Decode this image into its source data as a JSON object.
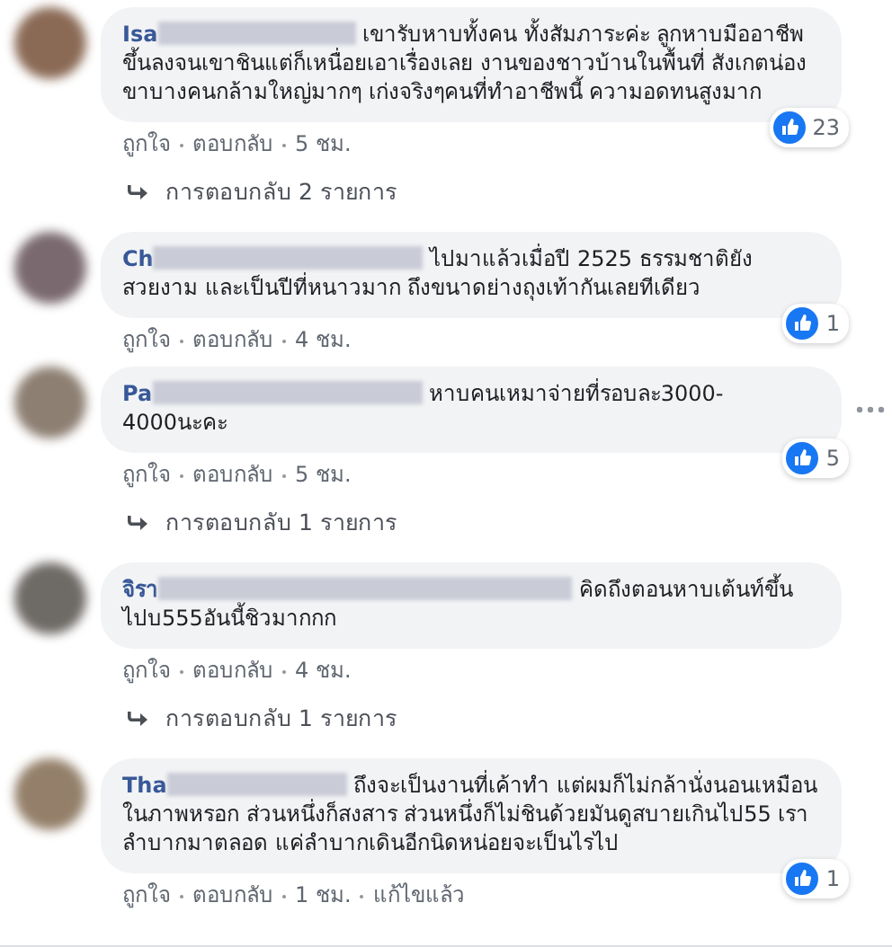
{
  "comments": [
    {
      "name": "Isa",
      "text": "เขารับหาบทั้งคน ทั้งสัมภาระค่ะ ลูกหาบมืออาชีพ ขึ้นลงจนเขาชินแต่ก็เหนื่อยเอาเรื่องเลย งานของชาวบ้านในพื้นที่ สังเกตน่องขาบางคนกล้ามใหญ่มากๆ เก่งจริงๆคนที่ทำอาชีพนี้ ความอดทนสูงมาก",
      "likes": "23",
      "actions": [
        "ถูกใจ",
        "ตอบกลับ",
        "5 ชม."
      ],
      "replies": "การตอบกลับ 2 รายการ",
      "hovered": false
    },
    {
      "name": "Ch",
      "text": "ไปมาแล้วเมื่อปี 2525 ธรรมชาติยังสวยงาม และเป็นปีที่หนาวมาก ถึงขนาดย่างถุงเท้ากันเลยทีเดียว",
      "likes": "1",
      "actions": [
        "ถูกใจ",
        "ตอบกลับ",
        "4 ชม."
      ],
      "hovered": false
    },
    {
      "name": "Pa",
      "text": "หาบคนเหมาจ่ายที่รอบละ3000-4000นะคะ",
      "likes": "5",
      "actions": [
        "ถูกใจ",
        "ตอบกลับ",
        "5 ชม."
      ],
      "replies": "การตอบกลับ 1 รายการ",
      "hovered": true
    },
    {
      "name": "จิรา",
      "text": "คิดถึงตอนหาบเต้นท์ขึ้นไปบ555อันนี้ชิวมากกก",
      "actions": [
        "ถูกใจ",
        "ตอบกลับ",
        "4 ชม."
      ],
      "replies": "การตอบกลับ 1 รายการ",
      "hovered": false
    },
    {
      "name": "Tha",
      "text": "ถึงจะเป็นงานที่เค้าทำ แต่ผมก็ไม่กล้านั่งนอนเหมือนในภาพหรอก ส่วนหนึ่งก็สงสาร ส่วนหนึ่งก็ไม่ชินด้วยมันดูสบายเกินไป55 เราลำบากมาตลอด แค่ลำบากเดินอีกนิดหน่อยจะเป็นไรไป",
      "likes": "1",
      "actions": [
        "ถูกใจ",
        "ตอบกลับ",
        "1 ชม.",
        "แก้ไขแล้ว"
      ],
      "hovered": false
    }
  ]
}
